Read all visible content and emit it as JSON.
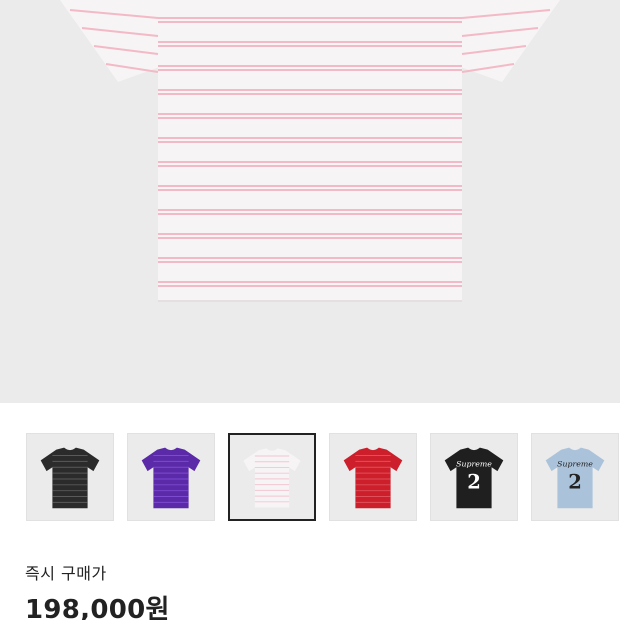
{
  "product": {
    "colors": {
      "background": "#ebebeb",
      "shirt_white": "#f6f4f5",
      "stripe_pink": "#f3b9c6"
    }
  },
  "thumbnails": [
    {
      "name": "thumb-black-stripe",
      "body": "#2b2b2b",
      "stripe": "#5a5a5a",
      "selected": false
    },
    {
      "name": "thumb-purple-stripe",
      "body": "#5b2aa8",
      "stripe": "#7d4bd0",
      "selected": false
    },
    {
      "name": "thumb-white-stripe",
      "body": "#f6f4f5",
      "stripe": "#f3c6d0",
      "selected": true
    },
    {
      "name": "thumb-red-stripe",
      "body": "#cc1f2b",
      "stripe": "#e0505a",
      "selected": false
    },
    {
      "name": "thumb-black-jersey",
      "body": "#1f1f1f",
      "stripe": "#1f1f1f",
      "selected": false
    },
    {
      "name": "thumb-lightblue-jersey",
      "body": "#aac3db",
      "stripe": "#aac3db",
      "selected": false
    }
  ],
  "jersey_text": {
    "brand": "Supreme",
    "number": "2"
  },
  "price": {
    "label": "즉시 구매가",
    "value": "198,000원"
  }
}
